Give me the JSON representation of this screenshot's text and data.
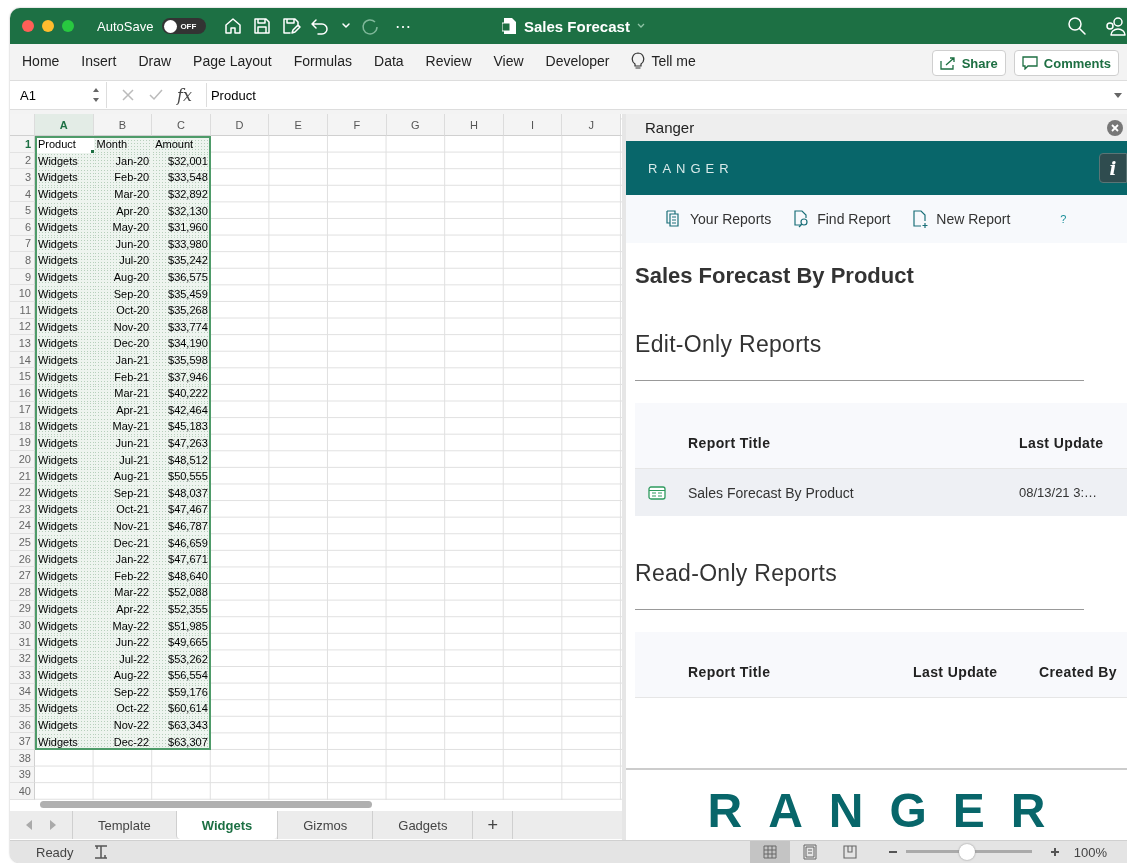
{
  "window": {
    "autosave_label": "AutoSave",
    "autosave": {
      "on": false,
      "label": "OFF"
    },
    "more": "⋯",
    "title": "Sales Forecast"
  },
  "ribbon": {
    "tabs": [
      "Home",
      "Insert",
      "Draw",
      "Page Layout",
      "Formulas",
      "Data",
      "Review",
      "View",
      "Developer"
    ],
    "tell_me": "Tell me",
    "buttons": [
      {
        "label": "Share",
        "kind": "share"
      },
      {
        "label": "Comments",
        "kind": "comments"
      }
    ]
  },
  "formula_bar": {
    "name_box": "A1",
    "fx": "fx",
    "value": "Product"
  },
  "sheet": {
    "columns": [
      {
        "label": "A",
        "selected": true
      },
      {
        "label": "B",
        "selected": false
      },
      {
        "label": "C",
        "selected": false
      },
      {
        "label": "D",
        "selected": false
      },
      {
        "label": "E",
        "selected": false
      },
      {
        "label": "F",
        "selected": false
      },
      {
        "label": "G",
        "selected": false
      },
      {
        "label": "H",
        "selected": false
      },
      {
        "label": "I",
        "selected": false
      },
      {
        "label": "J",
        "selected": false
      }
    ],
    "rows": [
      {
        "number": "1",
        "selected": true,
        "in_range": true,
        "cells": [
          "Product",
          "Month",
          "Amount"
        ]
      },
      {
        "number": "2",
        "selected": false,
        "in_range": true,
        "cells": [
          "Widgets",
          "Jan-20",
          "$32,001"
        ]
      },
      {
        "number": "3",
        "selected": false,
        "in_range": true,
        "cells": [
          "Widgets",
          "Feb-20",
          "$33,548"
        ]
      },
      {
        "number": "4",
        "selected": false,
        "in_range": true,
        "cells": [
          "Widgets",
          "Mar-20",
          "$32,892"
        ]
      },
      {
        "number": "5",
        "selected": false,
        "in_range": true,
        "cells": [
          "Widgets",
          "Apr-20",
          "$32,130"
        ]
      },
      {
        "number": "6",
        "selected": false,
        "in_range": true,
        "cells": [
          "Widgets",
          "May-20",
          "$31,960"
        ]
      },
      {
        "number": "7",
        "selected": false,
        "in_range": true,
        "cells": [
          "Widgets",
          "Jun-20",
          "$33,980"
        ]
      },
      {
        "number": "8",
        "selected": false,
        "in_range": true,
        "cells": [
          "Widgets",
          "Jul-20",
          "$35,242"
        ]
      },
      {
        "number": "9",
        "selected": false,
        "in_range": true,
        "cells": [
          "Widgets",
          "Aug-20",
          "$36,575"
        ]
      },
      {
        "number": "10",
        "selected": false,
        "in_range": true,
        "cells": [
          "Widgets",
          "Sep-20",
          "$35,459"
        ]
      },
      {
        "number": "11",
        "selected": false,
        "in_range": true,
        "cells": [
          "Widgets",
          "Oct-20",
          "$35,268"
        ]
      },
      {
        "number": "12",
        "selected": false,
        "in_range": true,
        "cells": [
          "Widgets",
          "Nov-20",
          "$33,774"
        ]
      },
      {
        "number": "13",
        "selected": false,
        "in_range": true,
        "cells": [
          "Widgets",
          "Dec-20",
          "$34,190"
        ]
      },
      {
        "number": "14",
        "selected": false,
        "in_range": true,
        "cells": [
          "Widgets",
          "Jan-21",
          "$35,598"
        ]
      },
      {
        "number": "15",
        "selected": false,
        "in_range": true,
        "cells": [
          "Widgets",
          "Feb-21",
          "$37,946"
        ]
      },
      {
        "number": "16",
        "selected": false,
        "in_range": true,
        "cells": [
          "Widgets",
          "Mar-21",
          "$40,222"
        ]
      },
      {
        "number": "17",
        "selected": false,
        "in_range": true,
        "cells": [
          "Widgets",
          "Apr-21",
          "$42,464"
        ]
      },
      {
        "number": "18",
        "selected": false,
        "in_range": true,
        "cells": [
          "Widgets",
          "May-21",
          "$45,183"
        ]
      },
      {
        "number": "19",
        "selected": false,
        "in_range": true,
        "cells": [
          "Widgets",
          "Jun-21",
          "$47,263"
        ]
      },
      {
        "number": "20",
        "selected": false,
        "in_range": true,
        "cells": [
          "Widgets",
          "Jul-21",
          "$48,512"
        ]
      },
      {
        "number": "21",
        "selected": false,
        "in_range": true,
        "cells": [
          "Widgets",
          "Aug-21",
          "$50,555"
        ]
      },
      {
        "number": "22",
        "selected": false,
        "in_range": true,
        "cells": [
          "Widgets",
          "Sep-21",
          "$48,037"
        ]
      },
      {
        "number": "23",
        "selected": false,
        "in_range": true,
        "cells": [
          "Widgets",
          "Oct-21",
          "$47,467"
        ]
      },
      {
        "number": "24",
        "selected": false,
        "in_range": true,
        "cells": [
          "Widgets",
          "Nov-21",
          "$46,787"
        ]
      },
      {
        "number": "25",
        "selected": false,
        "in_range": true,
        "cells": [
          "Widgets",
          "Dec-21",
          "$46,659"
        ]
      },
      {
        "number": "26",
        "selected": false,
        "in_range": true,
        "cells": [
          "Widgets",
          "Jan-22",
          "$47,671"
        ]
      },
      {
        "number": "27",
        "selected": false,
        "in_range": true,
        "cells": [
          "Widgets",
          "Feb-22",
          "$48,640"
        ]
      },
      {
        "number": "28",
        "selected": false,
        "in_range": true,
        "cells": [
          "Widgets",
          "Mar-22",
          "$52,088"
        ]
      },
      {
        "number": "29",
        "selected": false,
        "in_range": true,
        "cells": [
          "Widgets",
          "Apr-22",
          "$52,355"
        ]
      },
      {
        "number": "30",
        "selected": false,
        "in_range": true,
        "cells": [
          "Widgets",
          "May-22",
          "$51,985"
        ]
      },
      {
        "number": "31",
        "selected": false,
        "in_range": true,
        "cells": [
          "Widgets",
          "Jun-22",
          "$49,665"
        ]
      },
      {
        "number": "32",
        "selected": false,
        "in_range": true,
        "cells": [
          "Widgets",
          "Jul-22",
          "$53,262"
        ]
      },
      {
        "number": "33",
        "selected": false,
        "in_range": true,
        "cells": [
          "Widgets",
          "Aug-22",
          "$56,554"
        ]
      },
      {
        "number": "34",
        "selected": false,
        "in_range": true,
        "cells": [
          "Widgets",
          "Sep-22",
          "$59,176"
        ]
      },
      {
        "number": "35",
        "selected": false,
        "in_range": true,
        "cells": [
          "Widgets",
          "Oct-22",
          "$60,614"
        ]
      },
      {
        "number": "36",
        "selected": false,
        "in_range": true,
        "cells": [
          "Widgets",
          "Nov-22",
          "$63,343"
        ]
      },
      {
        "number": "37",
        "selected": false,
        "in_range": true,
        "cells": [
          "Widgets",
          "Dec-22",
          "$63,307"
        ]
      },
      {
        "number": "38",
        "selected": false,
        "in_range": false
      },
      {
        "number": "39",
        "selected": false,
        "in_range": false
      },
      {
        "number": "40",
        "selected": false,
        "in_range": false
      }
    ]
  },
  "sheet_tabs": [
    {
      "label": "Template",
      "selected": false
    },
    {
      "label": "Widgets",
      "selected": true
    },
    {
      "label": "Gizmos",
      "selected": false
    },
    {
      "label": "Gadgets",
      "selected": false
    }
  ],
  "add_sheet": "+",
  "status_bar": {
    "status": "Ready",
    "views": [
      {
        "kind": "normal",
        "selected": true
      },
      {
        "kind": "page_layout",
        "selected": false
      },
      {
        "kind": "page_break",
        "selected": false
      }
    ],
    "zoom": {
      "level": 0.49,
      "reading": "100%"
    }
  },
  "pane": {
    "title": "Ranger",
    "brand": "RANGER",
    "info": "i",
    "nav": [
      {
        "label": "Your Reports",
        "kind": "reports"
      },
      {
        "label": "Find Report",
        "kind": "find"
      },
      {
        "label": "New Report",
        "kind": "new"
      }
    ],
    "help": "?",
    "report_title": "Sales Forecast By Product",
    "sections": [
      {
        "title": "Edit-Only Reports",
        "columns": [
          "Report Title",
          "Last Update"
        ],
        "rows": [
          {
            "title": "Sales Forecast By Product",
            "last_update": "08/13/21 3:…"
          }
        ]
      },
      {
        "title": "Read-Only Reports",
        "columns": [
          "Report Title",
          "Last Update",
          "Created By"
        ]
      }
    ],
    "footer_logo": "RANGER"
  }
}
